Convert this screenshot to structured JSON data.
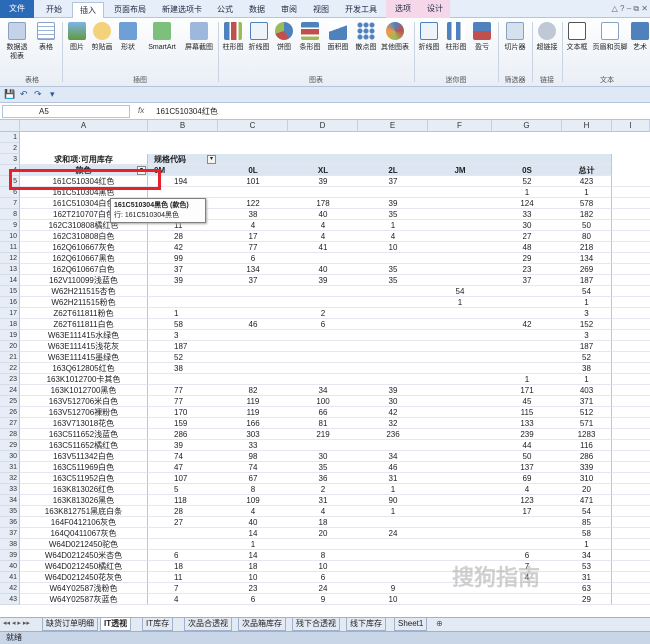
{
  "ribbon_tabs": [
    "文件",
    "开始",
    "插入",
    "页面布局",
    "新建选项卡",
    "公式",
    "数据",
    "审阅",
    "视图",
    "开发工具",
    "选项",
    "设计"
  ],
  "ribbon_buttons": [
    "数据透视表",
    "表格",
    "图片",
    "剪贴画",
    "形状",
    "SmartArt",
    "屏幕截图",
    "柱形图",
    "折线图",
    "饼图",
    "条形图",
    "面积图",
    "散点图",
    "其他图表",
    "折线图",
    "柱形图",
    "盈亏",
    "切片器",
    "超链接",
    "文本框",
    "页眉和页脚",
    "艺术"
  ],
  "ribbon_groups": [
    "表格",
    "插图",
    "图表",
    "迷你图",
    "筛选器",
    "链接",
    "文本"
  ],
  "namebox": "A5",
  "fx": "fx",
  "formula": "161C510304红色",
  "columns": [
    "A",
    "B",
    "C",
    "D",
    "E",
    "F",
    "G",
    "H",
    "I"
  ],
  "header_row3": [
    "求和项:可用库存",
    "规格代码",
    "",
    "",
    "",
    "",
    "",
    ""
  ],
  "header_row4": [
    "款色",
    "0M",
    "0L",
    "XL",
    "2L",
    "JM",
    "0S",
    "总计"
  ],
  "rows": [
    {
      "n": "5",
      "a": "161C510304红色",
      "v": [
        "194",
        "101",
        "39",
        "37",
        "",
        "52",
        "423"
      ]
    },
    {
      "n": "6",
      "a": "161C510304黑色",
      "v": [
        "",
        "",
        "",
        "",
        "",
        "1",
        "1"
      ]
    },
    {
      "n": "7",
      "a": "161C510304白色",
      "v": [
        "",
        "122",
        "178",
        "39",
        "",
        "124",
        "578"
      ]
    },
    {
      "n": "8",
      "a": "162T210707白色",
      "v": [
        "",
        "38",
        "40",
        "35",
        "",
        "33",
        "182"
      ]
    },
    {
      "n": "9",
      "a": "162C310808橘红色",
      "v": [
        "11",
        "4",
        "4",
        "1",
        "",
        "30",
        "50"
      ]
    },
    {
      "n": "10",
      "a": "162C310808白色",
      "v": [
        "28",
        "17",
        "4",
        "4",
        "",
        "27",
        "80"
      ]
    },
    {
      "n": "11",
      "a": "162Q610667灰色",
      "v": [
        "42",
        "77",
        "41",
        "10",
        "",
        "48",
        "218"
      ]
    },
    {
      "n": "12",
      "a": "162Q610667黑色",
      "v": [
        "99",
        "6",
        "",
        "",
        "",
        "29",
        "134"
      ]
    },
    {
      "n": "13",
      "a": "162Q610667白色",
      "v": [
        "37",
        "134",
        "40",
        "35",
        "",
        "23",
        "269"
      ]
    },
    {
      "n": "14",
      "a": "162V110099浅蓝色",
      "v": [
        "39",
        "37",
        "39",
        "35",
        "",
        "37",
        "187"
      ]
    },
    {
      "n": "15",
      "a": "W62H211515杏色",
      "v": [
        "",
        "",
        "",
        "",
        "54",
        "",
        "54"
      ]
    },
    {
      "n": "16",
      "a": "W62H211515粉色",
      "v": [
        "",
        "",
        "",
        "",
        "1",
        "",
        "1"
      ]
    },
    {
      "n": "17",
      "a": "Z62T611811粉色",
      "v": [
        "1",
        "",
        "2",
        "",
        "",
        "",
        "3"
      ]
    },
    {
      "n": "18",
      "a": "Z62T611811白色",
      "v": [
        "58",
        "46",
        "6",
        "",
        "",
        "42",
        "152"
      ]
    },
    {
      "n": "19",
      "a": "W63E111415水绿色",
      "v": [
        "3",
        "",
        "",
        "",
        "",
        "",
        "3"
      ]
    },
    {
      "n": "20",
      "a": "W63E111415浅花灰",
      "v": [
        "187",
        "",
        "",
        "",
        "",
        "",
        "187"
      ]
    },
    {
      "n": "21",
      "a": "W63E111415墨绿色",
      "v": [
        "52",
        "",
        "",
        "",
        "",
        "",
        "52"
      ]
    },
    {
      "n": "22",
      "a": "163Q612805红色",
      "v": [
        "38",
        "",
        "",
        "",
        "",
        "",
        "38"
      ]
    },
    {
      "n": "23",
      "a": "163K1012700卡其色",
      "v": [
        "",
        "",
        "",
        "",
        "",
        "1",
        "1"
      ]
    },
    {
      "n": "24",
      "a": "163K1012700黑色",
      "v": [
        "77",
        "82",
        "34",
        "39",
        "",
        "171",
        "403"
      ]
    },
    {
      "n": "25",
      "a": "163V512706米白色",
      "v": [
        "77",
        "119",
        "100",
        "30",
        "",
        "45",
        "371"
      ]
    },
    {
      "n": "26",
      "a": "163V512706裸粉色",
      "v": [
        "170",
        "119",
        "66",
        "42",
        "",
        "115",
        "512"
      ]
    },
    {
      "n": "27",
      "a": "163V713018花色",
      "v": [
        "159",
        "166",
        "81",
        "32",
        "",
        "133",
        "571"
      ]
    },
    {
      "n": "28",
      "a": "163C511652浅蓝色",
      "v": [
        "286",
        "303",
        "219",
        "236",
        "",
        "239",
        "1283"
      ]
    },
    {
      "n": "29",
      "a": "163C511652橘红色",
      "v": [
        "39",
        "33",
        "",
        "",
        "",
        "44",
        "116"
      ]
    },
    {
      "n": "30",
      "a": "163V511342白色",
      "v": [
        "74",
        "98",
        "30",
        "34",
        "",
        "50",
        "286"
      ]
    },
    {
      "n": "31",
      "a": "163C511969白色",
      "v": [
        "47",
        "74",
        "35",
        "46",
        "",
        "137",
        "339"
      ]
    },
    {
      "n": "32",
      "a": "163C511952白色",
      "v": [
        "107",
        "67",
        "36",
        "31",
        "",
        "69",
        "310"
      ]
    },
    {
      "n": "33",
      "a": "163K813026红色",
      "v": [
        "5",
        "8",
        "2",
        "1",
        "",
        "4",
        "20"
      ]
    },
    {
      "n": "34",
      "a": "163K813026黑色",
      "v": [
        "118",
        "109",
        "31",
        "90",
        "",
        "123",
        "471"
      ]
    },
    {
      "n": "35",
      "a": "163K812751黑底白条",
      "v": [
        "28",
        "4",
        "4",
        "1",
        "",
        "17",
        "54"
      ]
    },
    {
      "n": "36",
      "a": "164F0412106灰色",
      "v": [
        "27",
        "40",
        "18",
        "",
        "",
        "",
        "85"
      ]
    },
    {
      "n": "37",
      "a": "164Q0411067灰色",
      "v": [
        "",
        "14",
        "20",
        "24",
        "",
        "",
        "58"
      ]
    },
    {
      "n": "38",
      "a": "W64D0212450驼色",
      "v": [
        "",
        "1",
        "",
        "",
        "",
        "",
        "1"
      ]
    },
    {
      "n": "39",
      "a": "W64D0212450米杏色",
      "v": [
        "6",
        "14",
        "8",
        "",
        "",
        "6",
        "34"
      ]
    },
    {
      "n": "40",
      "a": "W64D0212450橘红色",
      "v": [
        "18",
        "18",
        "10",
        "",
        "",
        "7",
        "53"
      ]
    },
    {
      "n": "41",
      "a": "W64D0212450花灰色",
      "v": [
        "11",
        "10",
        "6",
        "",
        "",
        "4",
        "31"
      ]
    },
    {
      "n": "42",
      "a": "W64Y02587浅粉色",
      "v": [
        "7",
        "23",
        "24",
        "9",
        "",
        "",
        "63"
      ]
    },
    {
      "n": "43",
      "a": "W64Y02587灰蓝色",
      "v": [
        "4",
        "6",
        "9",
        "10",
        "",
        "",
        "29"
      ]
    }
  ],
  "tooltip": {
    "line1": "161C510304黑色 (款色)",
    "line2": "行: 161C510304黑色"
  },
  "sheet_tabs": [
    "缺货订单明细",
    "IT透视",
    "IT库存",
    "次品合透视",
    "次品箱库存",
    "残下合透视",
    "线下库存",
    "Sheet1"
  ],
  "status": "就绪",
  "watermark": "搜狗指南"
}
